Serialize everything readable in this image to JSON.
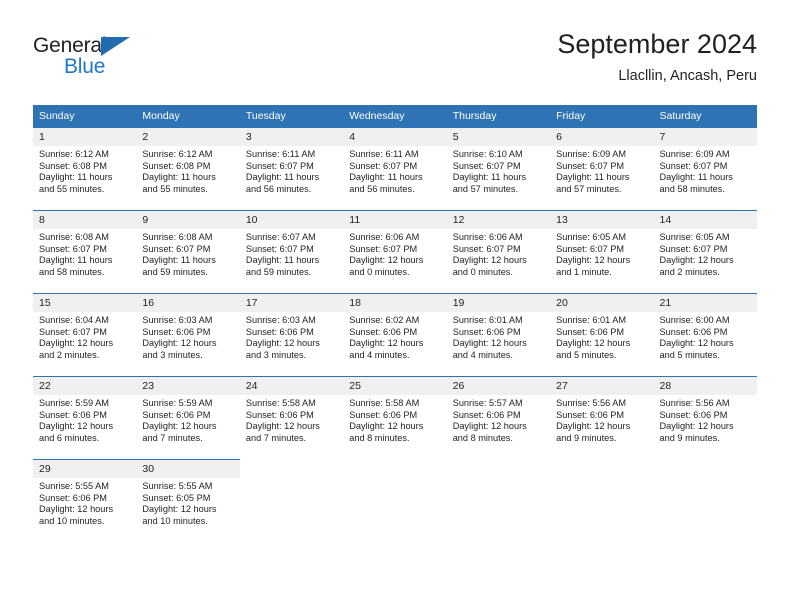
{
  "brand": {
    "name_part1": "General",
    "name_part2": "Blue",
    "logo_icon": "triangle-logo-icon",
    "accent_color": "#2079c4"
  },
  "header": {
    "month_title": "September 2024",
    "location": "Llacllin, Ancash, Peru"
  },
  "theme": {
    "header_bg": "#2e74b5",
    "daynum_bg": "#f0f0f0",
    "text": "#231f20"
  },
  "weekday_headers": [
    "Sunday",
    "Monday",
    "Tuesday",
    "Wednesday",
    "Thursday",
    "Friday",
    "Saturday"
  ],
  "weeks": [
    [
      {
        "day": "1",
        "sunrise": "Sunrise: 6:12 AM",
        "sunset": "Sunset: 6:08 PM",
        "daylight_line1": "Daylight: 11 hours",
        "daylight_line2": "and 55 minutes."
      },
      {
        "day": "2",
        "sunrise": "Sunrise: 6:12 AM",
        "sunset": "Sunset: 6:08 PM",
        "daylight_line1": "Daylight: 11 hours",
        "daylight_line2": "and 55 minutes."
      },
      {
        "day": "3",
        "sunrise": "Sunrise: 6:11 AM",
        "sunset": "Sunset: 6:07 PM",
        "daylight_line1": "Daylight: 11 hours",
        "daylight_line2": "and 56 minutes."
      },
      {
        "day": "4",
        "sunrise": "Sunrise: 6:11 AM",
        "sunset": "Sunset: 6:07 PM",
        "daylight_line1": "Daylight: 11 hours",
        "daylight_line2": "and 56 minutes."
      },
      {
        "day": "5",
        "sunrise": "Sunrise: 6:10 AM",
        "sunset": "Sunset: 6:07 PM",
        "daylight_line1": "Daylight: 11 hours",
        "daylight_line2": "and 57 minutes."
      },
      {
        "day": "6",
        "sunrise": "Sunrise: 6:09 AM",
        "sunset": "Sunset: 6:07 PM",
        "daylight_line1": "Daylight: 11 hours",
        "daylight_line2": "and 57 minutes."
      },
      {
        "day": "7",
        "sunrise": "Sunrise: 6:09 AM",
        "sunset": "Sunset: 6:07 PM",
        "daylight_line1": "Daylight: 11 hours",
        "daylight_line2": "and 58 minutes."
      }
    ],
    [
      {
        "day": "8",
        "sunrise": "Sunrise: 6:08 AM",
        "sunset": "Sunset: 6:07 PM",
        "daylight_line1": "Daylight: 11 hours",
        "daylight_line2": "and 58 minutes."
      },
      {
        "day": "9",
        "sunrise": "Sunrise: 6:08 AM",
        "sunset": "Sunset: 6:07 PM",
        "daylight_line1": "Daylight: 11 hours",
        "daylight_line2": "and 59 minutes."
      },
      {
        "day": "10",
        "sunrise": "Sunrise: 6:07 AM",
        "sunset": "Sunset: 6:07 PM",
        "daylight_line1": "Daylight: 11 hours",
        "daylight_line2": "and 59 minutes."
      },
      {
        "day": "11",
        "sunrise": "Sunrise: 6:06 AM",
        "sunset": "Sunset: 6:07 PM",
        "daylight_line1": "Daylight: 12 hours",
        "daylight_line2": "and 0 minutes."
      },
      {
        "day": "12",
        "sunrise": "Sunrise: 6:06 AM",
        "sunset": "Sunset: 6:07 PM",
        "daylight_line1": "Daylight: 12 hours",
        "daylight_line2": "and 0 minutes."
      },
      {
        "day": "13",
        "sunrise": "Sunrise: 6:05 AM",
        "sunset": "Sunset: 6:07 PM",
        "daylight_line1": "Daylight: 12 hours",
        "daylight_line2": "and 1 minute."
      },
      {
        "day": "14",
        "sunrise": "Sunrise: 6:05 AM",
        "sunset": "Sunset: 6:07 PM",
        "daylight_line1": "Daylight: 12 hours",
        "daylight_line2": "and 2 minutes."
      }
    ],
    [
      {
        "day": "15",
        "sunrise": "Sunrise: 6:04 AM",
        "sunset": "Sunset: 6:07 PM",
        "daylight_line1": "Daylight: 12 hours",
        "daylight_line2": "and 2 minutes."
      },
      {
        "day": "16",
        "sunrise": "Sunrise: 6:03 AM",
        "sunset": "Sunset: 6:06 PM",
        "daylight_line1": "Daylight: 12 hours",
        "daylight_line2": "and 3 minutes."
      },
      {
        "day": "17",
        "sunrise": "Sunrise: 6:03 AM",
        "sunset": "Sunset: 6:06 PM",
        "daylight_line1": "Daylight: 12 hours",
        "daylight_line2": "and 3 minutes."
      },
      {
        "day": "18",
        "sunrise": "Sunrise: 6:02 AM",
        "sunset": "Sunset: 6:06 PM",
        "daylight_line1": "Daylight: 12 hours",
        "daylight_line2": "and 4 minutes."
      },
      {
        "day": "19",
        "sunrise": "Sunrise: 6:01 AM",
        "sunset": "Sunset: 6:06 PM",
        "daylight_line1": "Daylight: 12 hours",
        "daylight_line2": "and 4 minutes."
      },
      {
        "day": "20",
        "sunrise": "Sunrise: 6:01 AM",
        "sunset": "Sunset: 6:06 PM",
        "daylight_line1": "Daylight: 12 hours",
        "daylight_line2": "and 5 minutes."
      },
      {
        "day": "21",
        "sunrise": "Sunrise: 6:00 AM",
        "sunset": "Sunset: 6:06 PM",
        "daylight_line1": "Daylight: 12 hours",
        "daylight_line2": "and 5 minutes."
      }
    ],
    [
      {
        "day": "22",
        "sunrise": "Sunrise: 5:59 AM",
        "sunset": "Sunset: 6:06 PM",
        "daylight_line1": "Daylight: 12 hours",
        "daylight_line2": "and 6 minutes."
      },
      {
        "day": "23",
        "sunrise": "Sunrise: 5:59 AM",
        "sunset": "Sunset: 6:06 PM",
        "daylight_line1": "Daylight: 12 hours",
        "daylight_line2": "and 7 minutes."
      },
      {
        "day": "24",
        "sunrise": "Sunrise: 5:58 AM",
        "sunset": "Sunset: 6:06 PM",
        "daylight_line1": "Daylight: 12 hours",
        "daylight_line2": "and 7 minutes."
      },
      {
        "day": "25",
        "sunrise": "Sunrise: 5:58 AM",
        "sunset": "Sunset: 6:06 PM",
        "daylight_line1": "Daylight: 12 hours",
        "daylight_line2": "and 8 minutes."
      },
      {
        "day": "26",
        "sunrise": "Sunrise: 5:57 AM",
        "sunset": "Sunset: 6:06 PM",
        "daylight_line1": "Daylight: 12 hours",
        "daylight_line2": "and 8 minutes."
      },
      {
        "day": "27",
        "sunrise": "Sunrise: 5:56 AM",
        "sunset": "Sunset: 6:06 PM",
        "daylight_line1": "Daylight: 12 hours",
        "daylight_line2": "and 9 minutes."
      },
      {
        "day": "28",
        "sunrise": "Sunrise: 5:56 AM",
        "sunset": "Sunset: 6:06 PM",
        "daylight_line1": "Daylight: 12 hours",
        "daylight_line2": "and 9 minutes."
      }
    ],
    [
      {
        "day": "29",
        "sunrise": "Sunrise: 5:55 AM",
        "sunset": "Sunset: 6:06 PM",
        "daylight_line1": "Daylight: 12 hours",
        "daylight_line2": "and 10 minutes."
      },
      {
        "day": "30",
        "sunrise": "Sunrise: 5:55 AM",
        "sunset": "Sunset: 6:05 PM",
        "daylight_line1": "Daylight: 12 hours",
        "daylight_line2": "and 10 minutes."
      },
      {
        "day": "",
        "sunrise": "",
        "sunset": "",
        "daylight_line1": "",
        "daylight_line2": ""
      },
      {
        "day": "",
        "sunrise": "",
        "sunset": "",
        "daylight_line1": "",
        "daylight_line2": ""
      },
      {
        "day": "",
        "sunrise": "",
        "sunset": "",
        "daylight_line1": "",
        "daylight_line2": ""
      },
      {
        "day": "",
        "sunrise": "",
        "sunset": "",
        "daylight_line1": "",
        "daylight_line2": ""
      },
      {
        "day": "",
        "sunrise": "",
        "sunset": "",
        "daylight_line1": "",
        "daylight_line2": ""
      }
    ]
  ]
}
